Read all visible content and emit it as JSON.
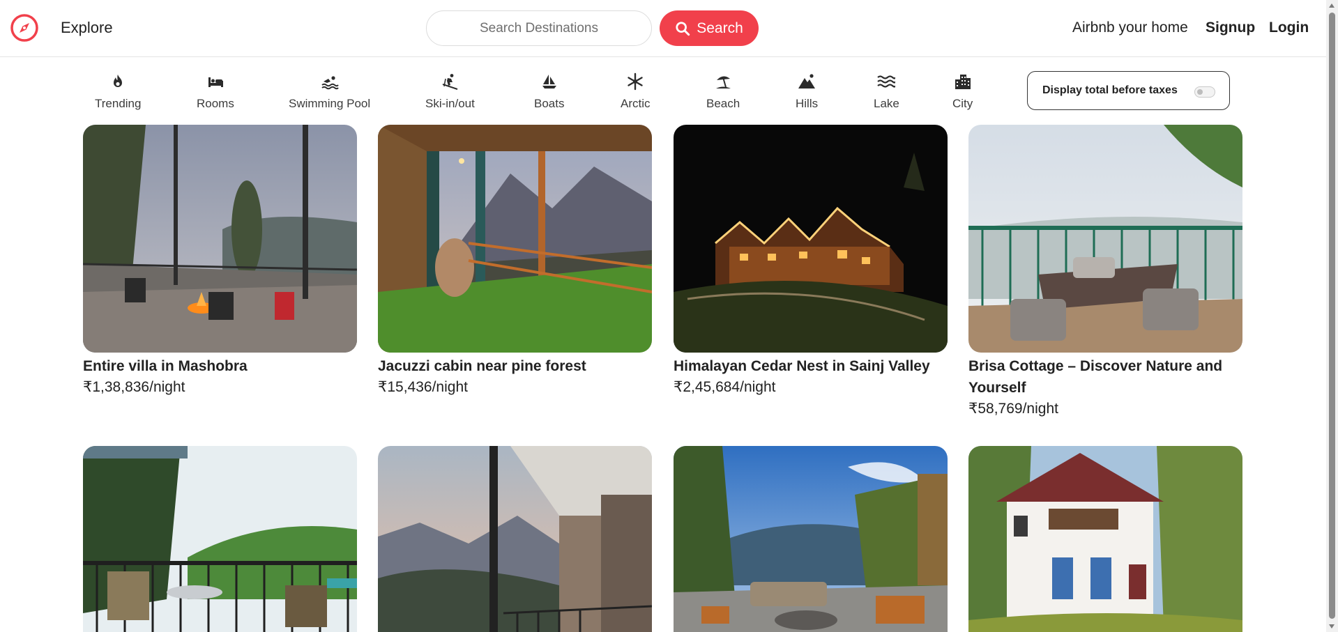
{
  "header": {
    "logo_icon": "compass-icon",
    "explore_label": "Explore",
    "search": {
      "placeholder": "Search Destinations",
      "button_label": "Search"
    },
    "host_link": "Airbnb your home",
    "signup_label": "Signup",
    "login_label": "Login"
  },
  "categories": [
    {
      "label": "Trending",
      "icon": "fire-icon"
    },
    {
      "label": "Rooms",
      "icon": "bed-icon"
    },
    {
      "label": "Swimming Pool",
      "icon": "swimmer-icon"
    },
    {
      "label": "Ski-in/out",
      "icon": "skiing-icon"
    },
    {
      "label": "Boats",
      "icon": "sailboat-icon"
    },
    {
      "label": "Arctic",
      "icon": "snowflake-icon"
    },
    {
      "label": "Beach",
      "icon": "umbrella-beach-icon"
    },
    {
      "label": "Hills",
      "icon": "mountain-icon"
    },
    {
      "label": "Lake",
      "icon": "water-icon"
    },
    {
      "label": "City",
      "icon": "city-icon"
    }
  ],
  "tax_toggle": {
    "label": "Display total before taxes",
    "enabled": false
  },
  "listings": [
    {
      "title": "Entire villa in Mashobra",
      "price": "₹1,38,836/night"
    },
    {
      "title": "Jacuzzi cabin near pine forest",
      "price": "₹15,436/night"
    },
    {
      "title": "Himalayan Cedar Nest in Sainj Valley",
      "price": "₹2,45,684/night"
    },
    {
      "title": "Brisa Cottage – Discover Nature and Yourself",
      "price": "₹58,769/night"
    },
    {
      "title": "",
      "price": ""
    },
    {
      "title": "",
      "price": ""
    },
    {
      "title": "",
      "price": ""
    },
    {
      "title": "",
      "price": ""
    }
  ],
  "colors": {
    "accent": "#f1404b",
    "text": "#222222",
    "border": "#e4e4e4"
  }
}
